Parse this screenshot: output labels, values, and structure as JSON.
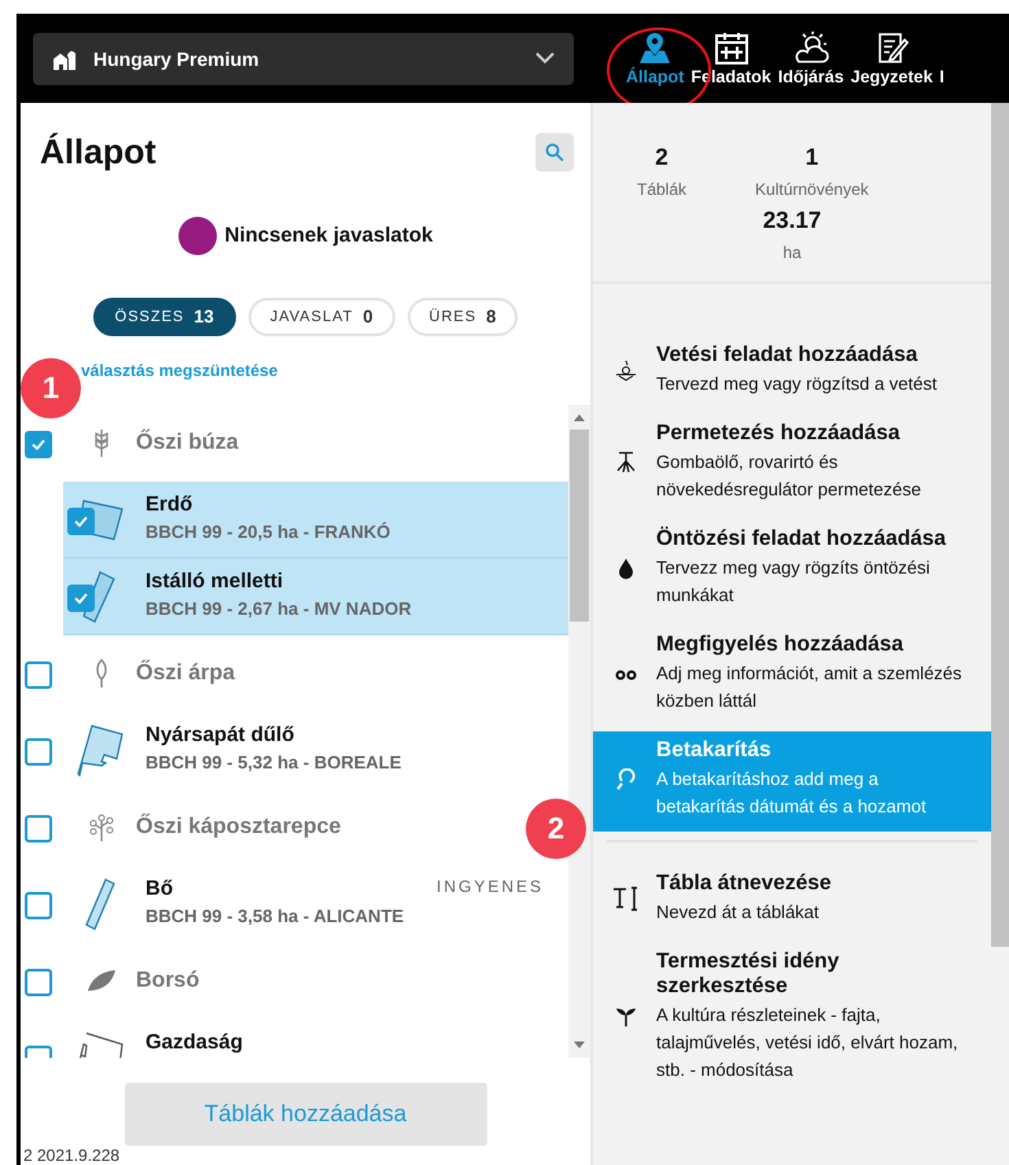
{
  "header": {
    "farm": "Hungary Premium",
    "nav": [
      {
        "label": "Állapot",
        "selected": true
      },
      {
        "label": "Feladatok",
        "selected": false
      },
      {
        "label": "Időjárás",
        "selected": false
      },
      {
        "label": "Jegyzetek",
        "selected": false
      },
      {
        "label": "I",
        "selected": false
      }
    ]
  },
  "annotations": [
    {
      "label": "1"
    },
    {
      "label": "2"
    }
  ],
  "left": {
    "title": "Állapot",
    "legend": {
      "label": "Nincsenek javaslatok",
      "color": "#951b81"
    },
    "filters": [
      {
        "label": "ÖSSZES",
        "count": "13",
        "selected": true
      },
      {
        "label": "JAVASLAT",
        "count": "0",
        "selected": false
      },
      {
        "label": "ÜRES",
        "count": "8",
        "selected": false
      }
    ],
    "deselect": "választás megszüntetése",
    "items": [
      {
        "kind": "crop",
        "name": "Őszi búza",
        "checked": true
      },
      {
        "kind": "field",
        "name": "Erdő",
        "details": "BBCH 99 - 20,5 ha - FRANKÓ",
        "checked": true,
        "selected": true
      },
      {
        "kind": "field",
        "name": "Istálló melletti",
        "details": "BBCH 99 - 2,67 ha - MV NADOR",
        "checked": true,
        "selected": true
      },
      {
        "kind": "crop",
        "name": "Őszi árpa",
        "checked": false
      },
      {
        "kind": "field",
        "name": "Nyársapát dűlő",
        "details": "BBCH 99 - 5,32 ha - BOREALE",
        "checked": false,
        "selected": false
      },
      {
        "kind": "crop",
        "name": "Őszi káposztarepce",
        "checked": false
      },
      {
        "kind": "field",
        "name": "Bő",
        "details": "BBCH 99 - 3,58 ha - ALICANTE",
        "badge": "INGYENES",
        "checked": false,
        "selected": false
      },
      {
        "kind": "crop",
        "name": "Borsó",
        "checked": false
      },
      {
        "kind": "field",
        "name": "Gazdaság",
        "checked": false,
        "selected": false
      }
    ],
    "add_button": "Táblák hozzáadása",
    "version": "2 2021.9.228"
  },
  "right": {
    "stats": [
      {
        "value": "2",
        "label": "Táblák"
      },
      {
        "value": "1",
        "label": "Kultúrnövények"
      },
      {
        "value": "23.17",
        "label": "ha"
      }
    ],
    "actions": [
      {
        "title": "Vetési feladat hozzáadása",
        "desc": "Tervezd meg vagy rögzítsd a vetést",
        "selected": false
      },
      {
        "title": "Permetezés hozzáadása",
        "desc": "Gombaölő, rovarirtó és növekedésregulátor permetezése",
        "selected": false
      },
      {
        "title": "Öntözési feladat hozzáadása",
        "desc": "Tervezz meg vagy rögzíts öntözési munkákat",
        "selected": false
      },
      {
        "title": "Megfigyelés hozzáadása",
        "desc": "Adj meg információt, amit a szemlézés közben láttál",
        "selected": false
      },
      {
        "title": "Betakarítás",
        "desc": "A betakarításhoz add meg a betakarítás dátumát és a hozamot",
        "selected": true,
        "divider_after": true
      },
      {
        "title": "Tábla átnevezése",
        "desc": "Nevezd át a táblákat",
        "selected": false
      },
      {
        "title": "Termesztési idény szerkesztése",
        "desc": "A kultúra részleteinek - fajta, talajművelés, vetési idő, elvárt hozam, stb. - módosítása",
        "selected": false
      }
    ]
  }
}
